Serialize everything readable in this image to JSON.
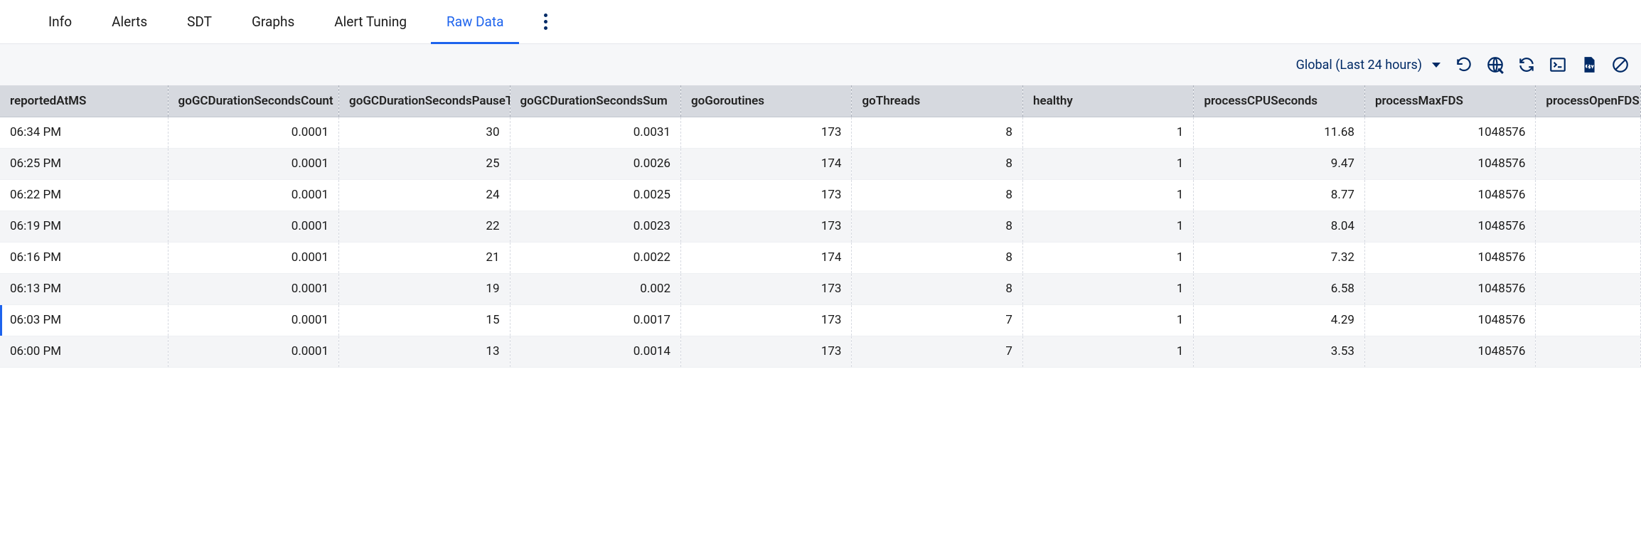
{
  "tabs": {
    "items": [
      {
        "label": "Info"
      },
      {
        "label": "Alerts"
      },
      {
        "label": "SDT"
      },
      {
        "label": "Graphs"
      },
      {
        "label": "Alert Tuning"
      },
      {
        "label": "Raw Data"
      }
    ],
    "activeIndex": 5
  },
  "toolbar": {
    "timeRange": "Global (Last 24 hours)",
    "icons": {
      "reset": "reset-icon",
      "globe": "globe-icon",
      "refresh": "refresh-icon",
      "console": "console-icon",
      "csv": "csv-icon",
      "nodata": "nodata-icon"
    }
  },
  "table": {
    "columns": [
      "reportedAtMS",
      "goGCDurationSecondsCount",
      "goGCDurationSecondsPauseTotal",
      "goGCDurationSecondsSum",
      "goGoroutines",
      "goThreads",
      "healthy",
      "processCPUSeconds",
      "processMaxFDS",
      "processOpenFDS"
    ],
    "rows": [
      {
        "t": "06:34 PM",
        "c1": "0.0001",
        "c2": "30",
        "c3": "0.0031",
        "c4": "173",
        "c5": "8",
        "c6": "1",
        "c7": "11.68",
        "c8": "1048576"
      },
      {
        "t": "06:25 PM",
        "c1": "0.0001",
        "c2": "25",
        "c3": "0.0026",
        "c4": "174",
        "c5": "8",
        "c6": "1",
        "c7": "9.47",
        "c8": "1048576"
      },
      {
        "t": "06:22 PM",
        "c1": "0.0001",
        "c2": "24",
        "c3": "0.0025",
        "c4": "173",
        "c5": "8",
        "c6": "1",
        "c7": "8.77",
        "c8": "1048576"
      },
      {
        "t": "06:19 PM",
        "c1": "0.0001",
        "c2": "22",
        "c3": "0.0023",
        "c4": "173",
        "c5": "8",
        "c6": "1",
        "c7": "8.04",
        "c8": "1048576"
      },
      {
        "t": "06:16 PM",
        "c1": "0.0001",
        "c2": "21",
        "c3": "0.0022",
        "c4": "174",
        "c5": "8",
        "c6": "1",
        "c7": "7.32",
        "c8": "1048576"
      },
      {
        "t": "06:13 PM",
        "c1": "0.0001",
        "c2": "19",
        "c3": "0.002",
        "c4": "173",
        "c5": "8",
        "c6": "1",
        "c7": "6.58",
        "c8": "1048576"
      },
      {
        "t": "06:03 PM",
        "c1": "0.0001",
        "c2": "15",
        "c3": "0.0017",
        "c4": "173",
        "c5": "7",
        "c6": "1",
        "c7": "4.29",
        "c8": "1048576"
      },
      {
        "t": "06:00 PM",
        "c1": "0.0001",
        "c2": "13",
        "c3": "0.0014",
        "c4": "173",
        "c5": "7",
        "c6": "1",
        "c7": "3.53",
        "c8": "1048576"
      }
    ],
    "highlightRowIndex": 6
  }
}
